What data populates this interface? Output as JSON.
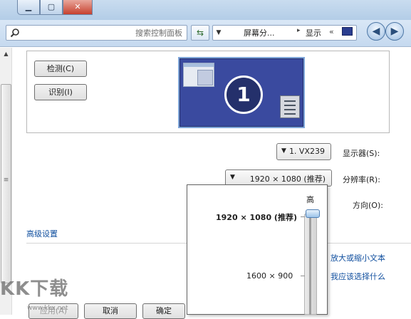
{
  "window": {
    "caption_buttons": {
      "close": "✕",
      "maximize": "▢",
      "minimize": "▁"
    }
  },
  "nav": {
    "search_placeholder": "搜索控制面板",
    "refresh_icon": "refresh-icon",
    "breadcrumb": [
      "屏幕分...",
      "显示"
    ],
    "breadcrumb_overflow": "«",
    "back_icon": "back-arrow-icon",
    "forward_icon": "forward-arrow-icon"
  },
  "preview": {
    "detect_button": "检测(C)",
    "identify_button": "识别(I)",
    "monitor_number": "1"
  },
  "settings": {
    "display_label": "显示器(S):",
    "display_value": "1. VX239",
    "resolution_label": "分辨率(R):",
    "resolution_value": "1920 × 1080 (推荐)",
    "orientation_label": "方向(O):",
    "advanced_link": "高级设置"
  },
  "links": {
    "make_text_larger": "放大或缩小文本",
    "which_settings": "我应该选择什么"
  },
  "popup": {
    "high_label": "高",
    "option_selected": "1920 × 1080 (推荐)",
    "option_second": "1600 × 900"
  },
  "footer": {
    "apply": "应用(A)",
    "cancel": "取消",
    "ok": "确定"
  },
  "watermark": {
    "text": "KK下载",
    "sub": "www.kkx.net"
  }
}
